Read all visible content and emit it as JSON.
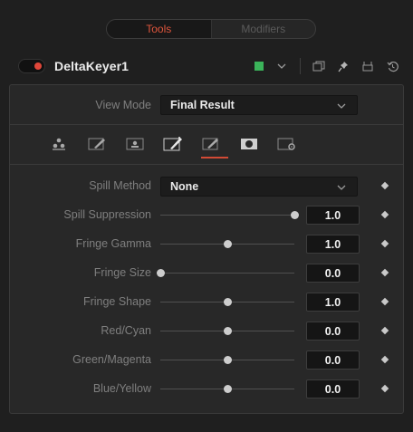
{
  "tabs": {
    "tools": "Tools",
    "modifiers": "Modifiers",
    "active": "tools"
  },
  "node": {
    "name": "DeltaKeyer1",
    "toggle_color": "#e0473a",
    "swatch_color": "#3bb35a",
    "icons": [
      "chevron-down-icon",
      "version-icon",
      "pin-icon",
      "lock-icon",
      "reset-icon"
    ]
  },
  "view_mode": {
    "label": "View Mode",
    "value": "Final Result"
  },
  "mode_icons": [
    "key-icon",
    "pre-matte-icon",
    "matte-icon",
    "fringe-icon",
    "tuning-icon",
    "mask-icon",
    "settings-icon"
  ],
  "active_mode_index": 3,
  "spill_method": {
    "label": "Spill Method",
    "value": "None"
  },
  "sliders": [
    {
      "label": "Spill Suppression",
      "value": "1.0",
      "position": 1.0
    },
    {
      "label": "Fringe Gamma",
      "value": "1.0",
      "position": 0.5
    },
    {
      "label": "Fringe Size",
      "value": "0.0",
      "position": 0.0
    },
    {
      "label": "Fringe Shape",
      "value": "1.0",
      "position": 0.5
    },
    {
      "label": "Red/Cyan",
      "value": "0.0",
      "position": 0.5
    },
    {
      "label": "Green/Magenta",
      "value": "0.0",
      "position": 0.5
    },
    {
      "label": "Blue/Yellow",
      "value": "0.0",
      "position": 0.5
    }
  ],
  "accent": "#e0563d"
}
